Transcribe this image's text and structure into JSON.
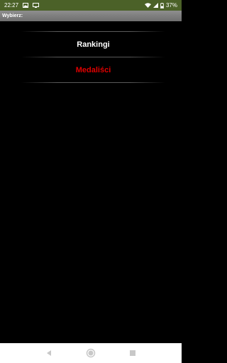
{
  "status_bar": {
    "time": "22:27",
    "battery_percent": "37%",
    "icons": [
      "image-icon",
      "cast-icon",
      "wifi-icon",
      "signal-icon",
      "battery-icon"
    ],
    "background_color": "#4b6128"
  },
  "title_bar": {
    "title": "Wybierz:"
  },
  "menu": {
    "items": [
      {
        "label": "Rankingi",
        "color": "#ffffff"
      },
      {
        "label": "Medaliści",
        "color": "#e00000"
      }
    ]
  },
  "nav_bar": {
    "buttons": [
      "back-icon",
      "home-icon",
      "recents-icon"
    ]
  }
}
